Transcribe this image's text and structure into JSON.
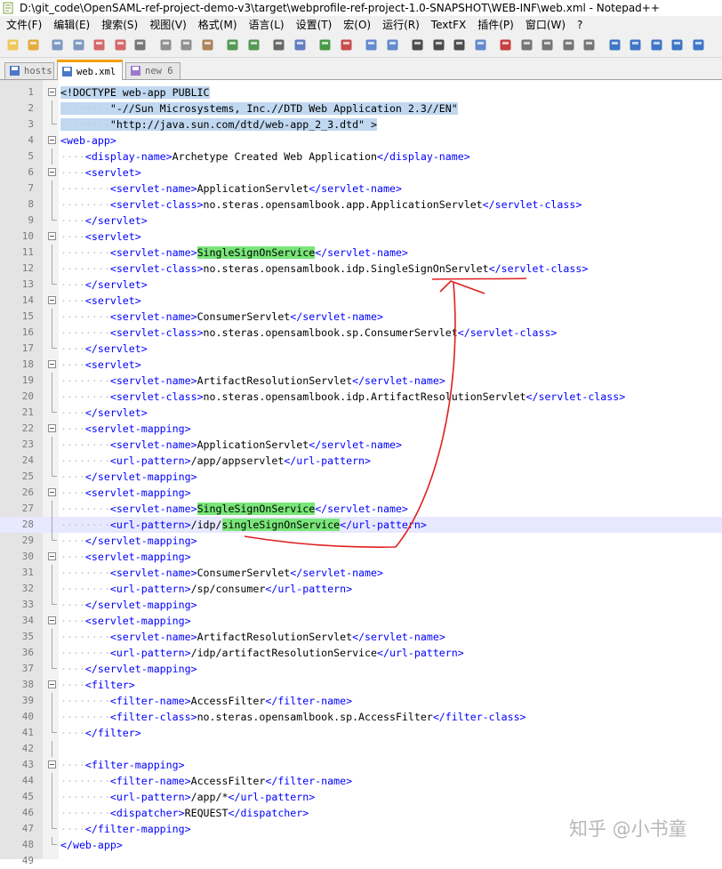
{
  "window": {
    "title": "D:\\git_code\\OpenSAML-ref-project-demo-v3\\target\\webprofile-ref-project-1.0-SNAPSHOT\\WEB-INF\\web.xml - Notepad++"
  },
  "menu": [
    "文件(F)",
    "编辑(E)",
    "搜索(S)",
    "视图(V)",
    "格式(M)",
    "语言(L)",
    "设置(T)",
    "宏(O)",
    "运行(R)",
    "TextFX",
    "插件(P)",
    "窗口(W)",
    "?"
  ],
  "toolbar_icons": [
    "new-file-icon",
    "open-file-icon",
    "save-icon",
    "save-all-icon",
    "close-icon",
    "close-all-icon",
    "print-icon",
    "cut-icon",
    "copy-icon",
    "paste-icon",
    "undo-icon",
    "redo-icon",
    "find-icon",
    "replace-icon",
    "zoom-in-icon",
    "zoom-out-icon",
    "sync-vertical-icon",
    "sync-horizontal-icon",
    "word-wrap-icon",
    "show-all-chars-icon",
    "indent-guide-icon",
    "user-lang-icon",
    "record-macro-icon",
    "stop-record-icon",
    "play-macro-icon",
    "run-macro-multiple-icon",
    "save-macro-icon",
    "trim-icon",
    "arrow-up-icon",
    "arrow-down-icon",
    "arrow-left-icon",
    "spell-icon"
  ],
  "tabs": [
    {
      "label": "hosts",
      "active": false
    },
    {
      "label": "web.xml",
      "active": true
    },
    {
      "label": "new  6",
      "active": false
    }
  ],
  "editor": {
    "lines": [
      {
        "n": "1",
        "text": "<!DOCTYPE web-app PUBLIC"
      },
      {
        "n": "2",
        "text": "        \"-//Sun Microsystems, Inc.//DTD Web Application 2.3//EN\""
      },
      {
        "n": "3",
        "text": "        \"http://java.sun.com/dtd/web-app_2_3.dtd\" >"
      },
      {
        "n": "4",
        "text": "<web-app>"
      },
      {
        "n": "5",
        "text": "    <display-name>Archetype Created Web Application</display-name>"
      },
      {
        "n": "6",
        "text": "    <servlet>"
      },
      {
        "n": "7",
        "text": "        <servlet-name>ApplicationServlet</servlet-name>"
      },
      {
        "n": "8",
        "text": "        <servlet-class>no.steras.opensamlbook.app.ApplicationServlet</servlet-class>"
      },
      {
        "n": "9",
        "text": "    </servlet>"
      },
      {
        "n": "10",
        "text": "    <servlet>"
      },
      {
        "n": "11",
        "text": "        <servlet-name>SingleSignOnService</servlet-name>"
      },
      {
        "n": "12",
        "text": "        <servlet-class>no.steras.opensamlbook.idp.SingleSignOnServlet</servlet-class>"
      },
      {
        "n": "13",
        "text": "    </servlet>"
      },
      {
        "n": "14",
        "text": "    <servlet>"
      },
      {
        "n": "15",
        "text": "        <servlet-name>ConsumerServlet</servlet-name>"
      },
      {
        "n": "16",
        "text": "        <servlet-class>no.steras.opensamlbook.sp.ConsumerServlet</servlet-class>"
      },
      {
        "n": "17",
        "text": "    </servlet>"
      },
      {
        "n": "18",
        "text": "    <servlet>"
      },
      {
        "n": "19",
        "text": "        <servlet-name>ArtifactResolutionServlet</servlet-name>"
      },
      {
        "n": "20",
        "text": "        <servlet-class>no.steras.opensamlbook.idp.ArtifactResolutionServlet</servlet-class>"
      },
      {
        "n": "21",
        "text": "    </servlet>"
      },
      {
        "n": "22",
        "text": "    <servlet-mapping>"
      },
      {
        "n": "23",
        "text": "        <servlet-name>ApplicationServlet</servlet-name>"
      },
      {
        "n": "24",
        "text": "        <url-pattern>/app/appservlet</url-pattern>"
      },
      {
        "n": "25",
        "text": "    </servlet-mapping>"
      },
      {
        "n": "26",
        "text": "    <servlet-mapping>"
      },
      {
        "n": "27",
        "text": "        <servlet-name>SingleSignOnService</servlet-name>"
      },
      {
        "n": "28",
        "text": "        <url-pattern>/idp/singleSignOnService</url-pattern>"
      },
      {
        "n": "29",
        "text": "    </servlet-mapping>"
      },
      {
        "n": "30",
        "text": "    <servlet-mapping>"
      },
      {
        "n": "31",
        "text": "        <servlet-name>ConsumerServlet</servlet-name>"
      },
      {
        "n": "32",
        "text": "        <url-pattern>/sp/consumer</url-pattern>"
      },
      {
        "n": "33",
        "text": "    </servlet-mapping>"
      },
      {
        "n": "34",
        "text": "    <servlet-mapping>"
      },
      {
        "n": "35",
        "text": "        <servlet-name>ArtifactResolutionServlet</servlet-name>"
      },
      {
        "n": "36",
        "text": "        <url-pattern>/idp/artifactResolutionService</url-pattern>"
      },
      {
        "n": "37",
        "text": "    </servlet-mapping>"
      },
      {
        "n": "38",
        "text": "    <filter>"
      },
      {
        "n": "39",
        "text": "        <filter-name>AccessFilter</filter-name>"
      },
      {
        "n": "40",
        "text": "        <filter-class>no.steras.opensamlbook.sp.AccessFilter</filter-class>"
      },
      {
        "n": "41",
        "text": "    </filter>"
      },
      {
        "n": "42",
        "text": ""
      },
      {
        "n": "43",
        "text": "    <filter-mapping>"
      },
      {
        "n": "44",
        "text": "        <filter-name>AccessFilter</filter-name>"
      },
      {
        "n": "45",
        "text": "        <url-pattern>/app/*</url-pattern>"
      },
      {
        "n": "46",
        "text": "        <dispatcher>REQUEST</dispatcher>"
      },
      {
        "n": "47",
        "text": "    </filter-mapping>"
      },
      {
        "n": "48",
        "text": "</web-app>"
      },
      {
        "n": "49",
        "text": ""
      }
    ],
    "current_line": "28",
    "selected_lines": [
      "1",
      "2",
      "3"
    ],
    "highlighted_words": [
      "SingleSignOnService",
      "singleSignOnService"
    ]
  },
  "watermark": "知乎 @小书童",
  "colors": {
    "tag": "#0000ff",
    "highlight": "#78e678",
    "selection": "#c0d8f0",
    "annotation": "#e02020",
    "active_tab_accent": "#f6a000"
  }
}
